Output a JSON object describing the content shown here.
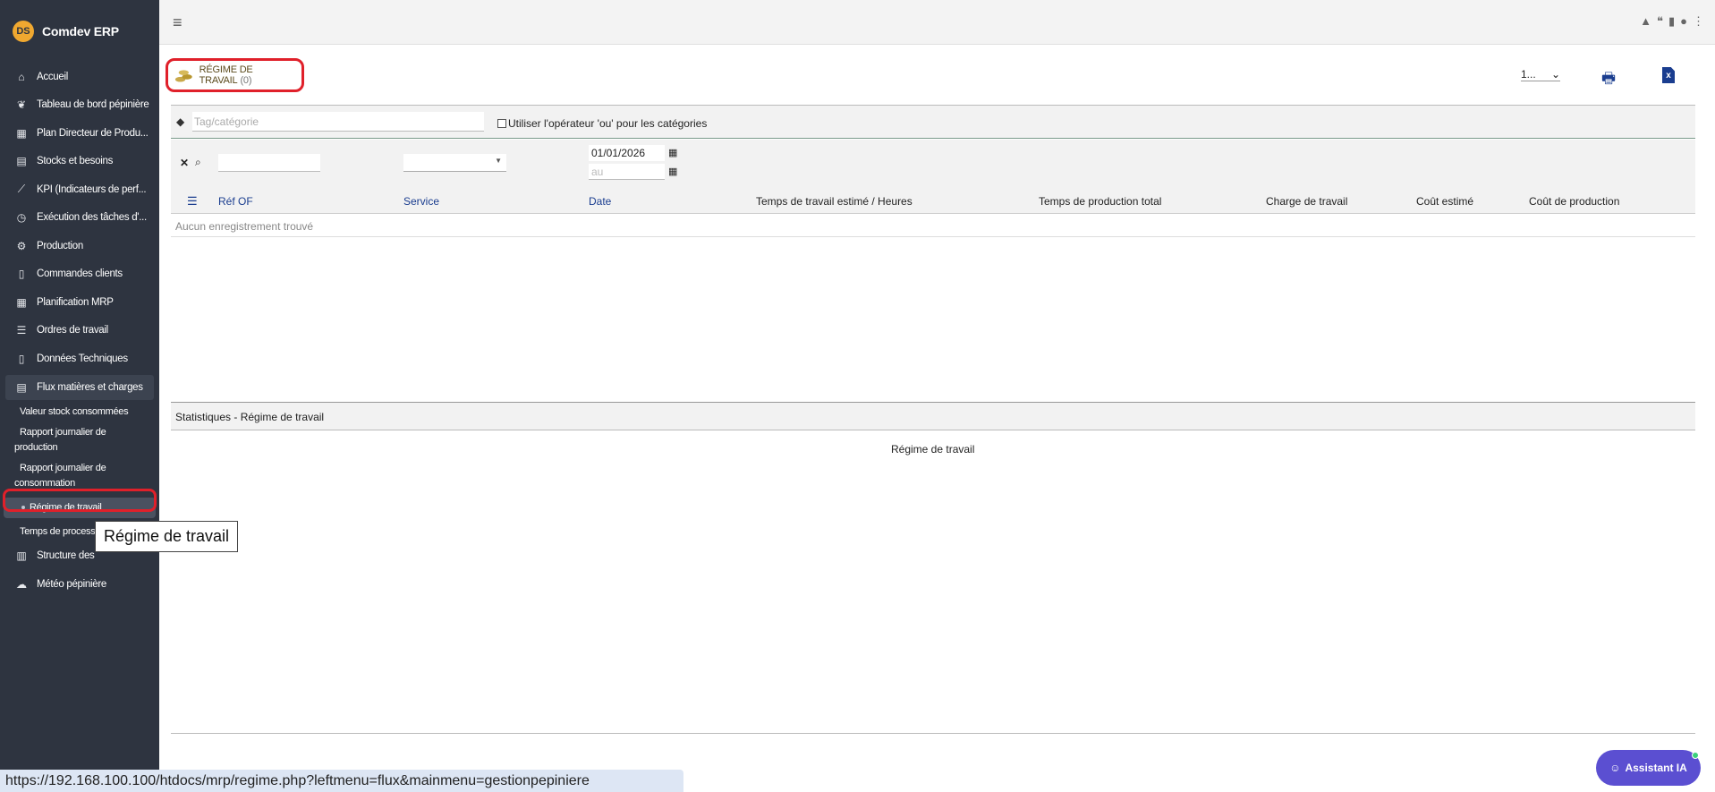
{
  "app": {
    "name": "Comdev ERP",
    "logo_text": "DS"
  },
  "sidebar": {
    "items": [
      {
        "label": "Accueil",
        "icon": "home-icon",
        "glyph": "⌂"
      },
      {
        "label": "Tableau de bord pépinière",
        "icon": "leaf-icon",
        "glyph": "❦"
      },
      {
        "label": "Plan Directeur de Produ...",
        "icon": "calendar-icon",
        "glyph": "▦"
      },
      {
        "label": "Stocks et besoins",
        "icon": "boxes-icon",
        "glyph": "▤"
      },
      {
        "label": "KPI (Indicateurs de perf...",
        "icon": "chart-line-icon",
        "glyph": "⟋"
      },
      {
        "label": "Exécution des tâches d'...",
        "icon": "clock-icon",
        "glyph": "◷"
      },
      {
        "label": "Production",
        "icon": "gears-icon",
        "glyph": "⚙"
      },
      {
        "label": "Commandes clients",
        "icon": "document-icon",
        "glyph": "▯"
      },
      {
        "label": "Planification MRP",
        "icon": "calendar-icon",
        "glyph": "▦"
      },
      {
        "label": "Ordres de travail",
        "icon": "list-check-icon",
        "glyph": "☰"
      },
      {
        "label": "Données Techniques",
        "icon": "file-icon",
        "glyph": "▯"
      }
    ],
    "open_item": {
      "label": "Flux matières et charges",
      "icon": "boxes-icon",
      "glyph": "▤"
    },
    "sub_items": [
      "Valeur stock consommées",
      "Rapport journalier de production",
      "Rapport journalier de consommation",
      "Régime de travail",
      "Temps de process"
    ],
    "bottom_items": [
      {
        "label": "Structure des",
        "icon": "building-icon",
        "glyph": "▥"
      },
      {
        "label": "Météo pépinière",
        "icon": "cloud-sun-icon",
        "glyph": "☁"
      }
    ]
  },
  "tooltip": "Régime de travail",
  "page": {
    "title": "RÉGIME DE TRAVAIL",
    "count": "(0)",
    "limit_value": "1...",
    "tag_placeholder": "Tag/catégorie",
    "or_operator_label": "Utiliser l'opérateur 'ou' pour les catégories",
    "date_from": "01/01/2026",
    "date_to_placeholder": "au",
    "columns": [
      "Réf OF",
      "Service",
      "Date",
      "Temps de travail estimé / Heures",
      "Temps de production total",
      "Charge de travail",
      "Coût estimé",
      "Coût de production"
    ],
    "empty_message": "Aucun enregistrement trouvé",
    "stats_title": "Statistiques - Régime de travail",
    "stats_label": "Régime de travail"
  },
  "assistant_label": "Assistant IA",
  "status_url": "https://192.168.100.100/htdocs/mrp/regime.php?leftmenu=flux&mainmenu=gestionpepiniere"
}
